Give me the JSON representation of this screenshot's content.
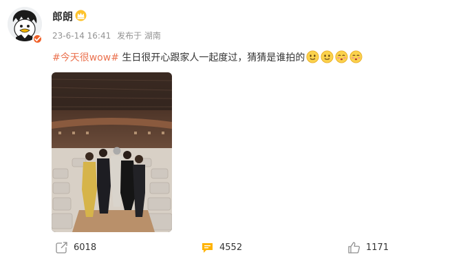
{
  "user": {
    "name": "郎朗",
    "badge_icon": "crown-icon",
    "avatar_icon": "penguin-cartoon-avatar",
    "verified_icon": "verified-badge-icon"
  },
  "post": {
    "time": "23-6-14 16:41",
    "source": "发布于 湖南",
    "hashtag": "#今天很wow#",
    "text": " 生日很开心跟家人一起度过，猜猜是谁拍的",
    "emojis": [
      "smile-emoji",
      "smile-emoji",
      "shy-emoji",
      "shy-emoji"
    ],
    "image": "group-photo-concert-hall"
  },
  "actions": {
    "repost": "6018",
    "comment": "4552",
    "like": "1171"
  },
  "colors": {
    "hashtag": "#eb7350",
    "accent": "#ff8200",
    "meta_text": "#939393"
  }
}
